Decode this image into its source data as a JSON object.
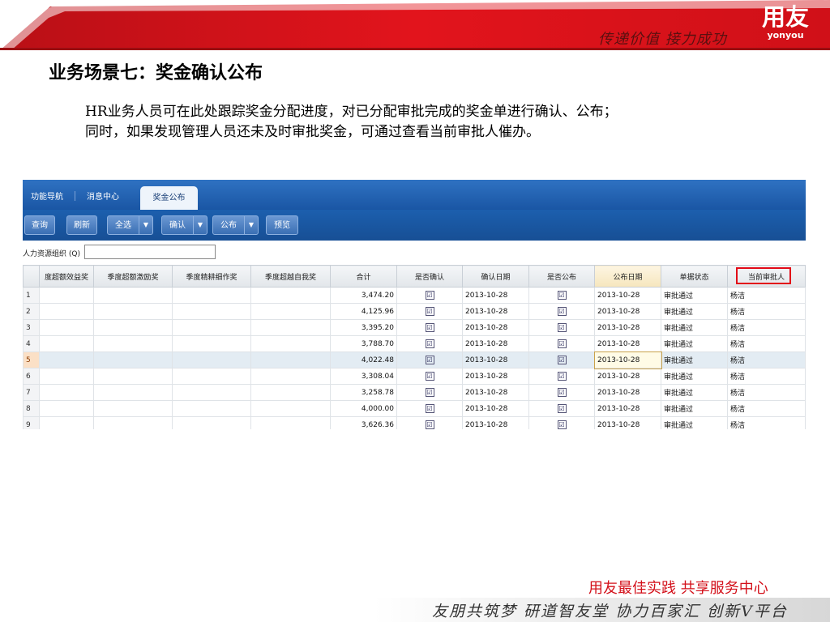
{
  "banner": {
    "slogan": "传递价值 接力成功",
    "logo_cn": "用友",
    "logo_en": "yonyou",
    "colors": {
      "red": "#e2141c",
      "dark_red": "#9b0d12"
    }
  },
  "slide": {
    "title": "业务场景七：奖金确认公布",
    "desc_line1": "HR业务人员可在此处跟踪奖金分配进度，对已分配审批完成的奖金单进行确认、公布；",
    "desc_line2": "同时，如果发现管理人员还未及时审批奖金，可通过查看当前审批人催办。"
  },
  "app": {
    "tabs": [
      {
        "label": "功能导航",
        "active": false
      },
      {
        "label": "消息中心",
        "active": false
      },
      {
        "label": "奖金公布",
        "active": true
      }
    ],
    "toolbar": {
      "query": "查询",
      "refresh": "刷新",
      "select_all": "全选",
      "confirm": "确认",
      "publish": "公布",
      "preview": "预览",
      "dropdown_arrow": "▼"
    },
    "filter": {
      "label": "人力资源组织 (Q)",
      "value": ""
    },
    "columns": [
      "度超额效益奖",
      "季度超额激励奖",
      "季度精耕细作奖",
      "季度超越自我奖",
      "合计",
      "是否确认",
      "确认日期",
      "是否公布",
      "公布日期",
      "单据状态",
      "当前审批人"
    ],
    "rows": [
      {
        "no": "1",
        "total": "3,474.20",
        "confirmed": "☑",
        "confirm_date": "2013-10-28",
        "published": "☑",
        "publish_date": "2013-10-28",
        "status": "审批通过",
        "approver": "杨洁"
      },
      {
        "no": "2",
        "total": "4,125.96",
        "confirmed": "☑",
        "confirm_date": "2013-10-28",
        "published": "☑",
        "publish_date": "2013-10-28",
        "status": "审批通过",
        "approver": "杨洁"
      },
      {
        "no": "3",
        "total": "3,395.20",
        "confirmed": "☑",
        "confirm_date": "2013-10-28",
        "published": "☑",
        "publish_date": "2013-10-28",
        "status": "审批通过",
        "approver": "杨洁"
      },
      {
        "no": "4",
        "total": "3,788.70",
        "confirmed": "☑",
        "confirm_date": "2013-10-28",
        "published": "☑",
        "publish_date": "2013-10-28",
        "status": "审批通过",
        "approver": "杨洁"
      },
      {
        "no": "5",
        "total": "4,022.48",
        "confirmed": "☑",
        "confirm_date": "2013-10-28",
        "published": "☑",
        "publish_date": "2013-10-28",
        "status": "审批通过",
        "approver": "杨洁"
      },
      {
        "no": "6",
        "total": "3,308.04",
        "confirmed": "☑",
        "confirm_date": "2013-10-28",
        "published": "☑",
        "publish_date": "2013-10-28",
        "status": "审批通过",
        "approver": "杨洁"
      },
      {
        "no": "7",
        "total": "3,258.78",
        "confirmed": "☑",
        "confirm_date": "2013-10-28",
        "published": "☑",
        "publish_date": "2013-10-28",
        "status": "审批通过",
        "approver": "杨洁"
      },
      {
        "no": "8",
        "total": "4,000.00",
        "confirmed": "☑",
        "confirm_date": "2013-10-28",
        "published": "☑",
        "publish_date": "2013-10-28",
        "status": "审批通过",
        "approver": "杨洁"
      },
      {
        "no": "9",
        "total": "3,626.36",
        "confirmed": "☑",
        "confirm_date": "2013-10-28",
        "published": "☑",
        "publish_date": "2013-10-28",
        "status": "审批通过",
        "approver": "杨洁"
      }
    ],
    "selected_row": 5
  },
  "footer": {
    "text": "用友最佳实践  共享服务中心",
    "motto": "友朋共筑梦  研道智友堂  协力百家汇  创新V平台"
  }
}
